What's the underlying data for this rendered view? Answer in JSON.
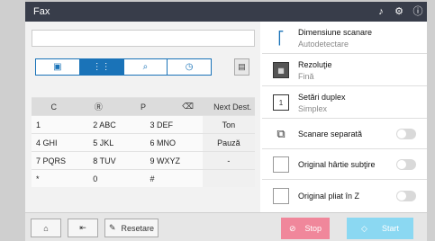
{
  "titlebar": {
    "title": "Fax",
    "icons": [
      "bell-icon",
      "settings-icon",
      "info-icon"
    ]
  },
  "tabs": [
    {
      "icon": "book-icon"
    },
    {
      "icon": "keypad-icon"
    },
    {
      "icon": "search-icon"
    },
    {
      "icon": "history-icon"
    }
  ],
  "keypad": {
    "top": [
      "C",
      "Ⓡ",
      "P",
      "⌫",
      "Next Dest."
    ],
    "rows": [
      [
        "1",
        "2 ABC",
        "3 DEF",
        "Ton"
      ],
      [
        "4 GHI",
        "5 JKL",
        "6 MNO",
        "Pauză"
      ],
      [
        "7 PQRS",
        "8 TUV",
        "9 WXYZ",
        "-"
      ],
      [
        "*",
        "0",
        "#",
        ""
      ]
    ]
  },
  "settings": [
    {
      "label": "Dimensiune scanare",
      "value": "Autodetectare",
      "icon": "scan-size-icon"
    },
    {
      "label": "Rezoluţie",
      "value": "Fină",
      "icon": "resolution-icon"
    },
    {
      "label": "Setări duplex",
      "value": "Simplex",
      "icon": "duplex-icon"
    },
    {
      "label": "Scanare separată",
      "icon": "separate-scan-icon"
    },
    {
      "label": "Original hârtie subţire",
      "icon": "thin-paper-icon"
    },
    {
      "label": "Original pliat în Z",
      "icon": "z-fold-icon"
    }
  ],
  "bottom": {
    "reset": "Resetare",
    "stop": "Stop",
    "start": "Start"
  }
}
